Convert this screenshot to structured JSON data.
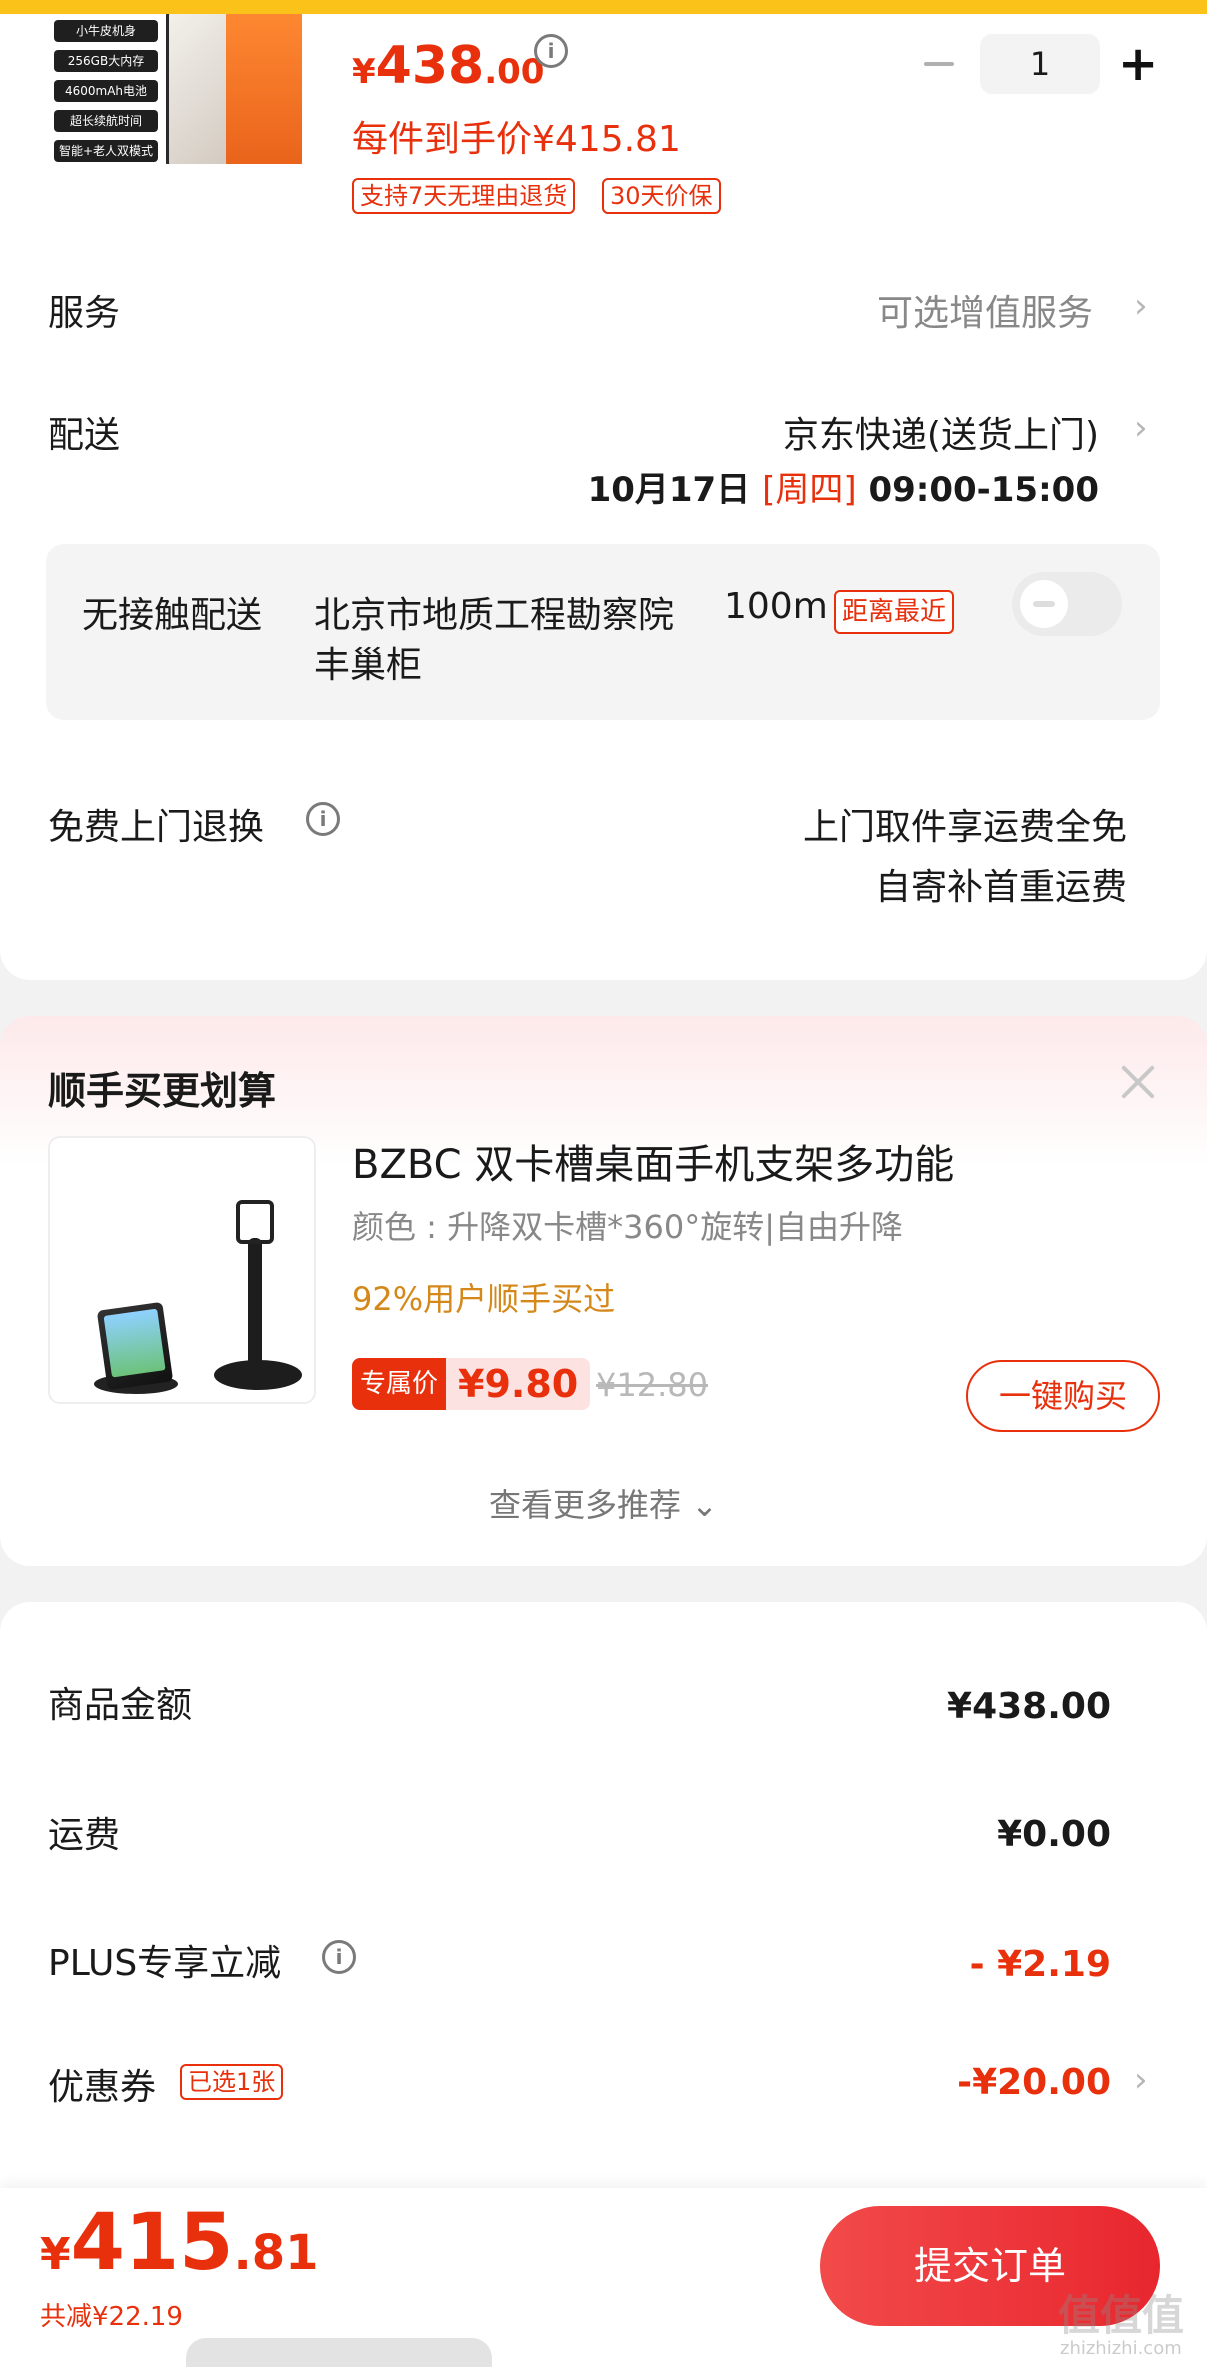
{
  "product": {
    "image_tags": [
      "小牛皮机身",
      "256GB大内存",
      "4600mAh电池",
      "超长续航时间",
      "智能+老人双模式"
    ],
    "price_yen": "¥",
    "price_int": "438",
    "price_dec": ".00",
    "per_price": "每件到手价¥415.81",
    "badges": [
      "支持7天无理由退货",
      "30天价保"
    ],
    "quantity": "1",
    "minus_symbol": "−",
    "plus_symbol": "+"
  },
  "service": {
    "label": "服务",
    "value": "可选增值服务"
  },
  "delivery": {
    "label": "配送",
    "method": "京东快递(送货上门)",
    "date": "10月17日",
    "weekday": "[周四]",
    "time": "09:00-15:00"
  },
  "contactless": {
    "label": "无接触配送",
    "place": "北京市地质工程勘察院",
    "distance": "100m",
    "nearest_badge": "距离最近",
    "place_line2": "丰巢柜",
    "toggle_on": false
  },
  "free_return": {
    "label": "免费上门退换",
    "line1": "上门取件享运费全免",
    "line2": "自寄补首重运费"
  },
  "recommend": {
    "title": "顺手买更划算",
    "item_name": "BZBC 双卡槽桌面手机支架多功能",
    "item_spec": "颜色 : 升降双卡槽*360°旋转|自由升降",
    "bought": "92%用户顺手买过",
    "price_tag": "专属价",
    "price": "¥9.80",
    "old_price": "¥12.80",
    "buy_label": "一键购买",
    "more_label": "查看更多推荐 ⌄"
  },
  "amounts": {
    "goods_label": "商品金额",
    "goods_value": "¥438.00",
    "shipping_label": "运费",
    "shipping_value": "¥0.00",
    "plus_label": "PLUS专享立减",
    "plus_value": "- ¥2.19",
    "coupon_label": "优惠券",
    "coupon_badge": "已选1张",
    "coupon_value": "-¥20.00"
  },
  "footer": {
    "total_yen": "¥",
    "total_int": "415",
    "total_dec": ".81",
    "saved": "共减¥22.19",
    "submit_label": "提交订单",
    "watermark": "值值值",
    "watermark_sub": "zhizhizhi.com"
  },
  "colors": {
    "accent_red": "#e8300d",
    "top_bar_yellow": "#fbc21a",
    "orange_text": "#d4881a"
  },
  "icons": [
    "info-icon",
    "chevron-right-icon",
    "close-icon",
    "minus-icon",
    "plus-icon"
  ]
}
